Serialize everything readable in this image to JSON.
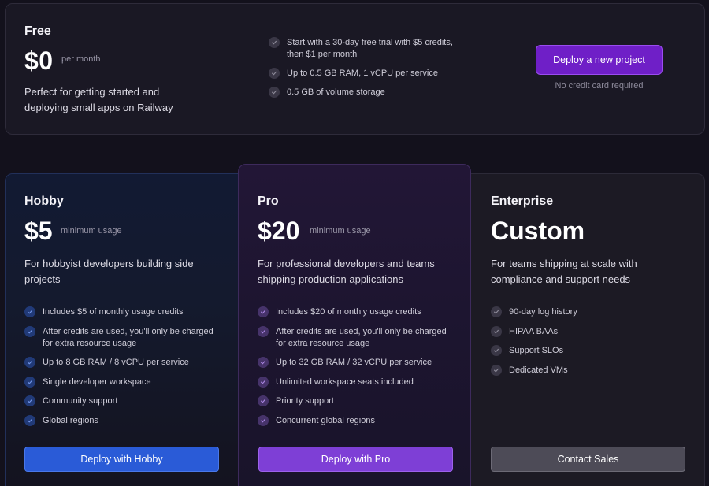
{
  "free": {
    "name": "Free",
    "price": "$0",
    "price_suffix": "per month",
    "description": "Perfect for getting started and deploying small apps on Railway",
    "features": [
      "Start with a 30-day free trial with $5 credits, then $1 per month",
      "Up to 0.5 GB RAM, 1 vCPU per service",
      "0.5 GB of volume storage"
    ],
    "cta": "Deploy a new project",
    "note": "No credit card required"
  },
  "hobby": {
    "name": "Hobby",
    "price": "$5",
    "price_suffix": "minimum usage",
    "description": "For hobbyist developers building side projects",
    "features": [
      "Includes $5 of monthly usage credits",
      "After credits are used, you'll only be charged for extra resource usage",
      "Up to 8 GB RAM / 8 vCPU per service",
      "Single developer workspace",
      "Community support",
      "Global regions"
    ],
    "cta": "Deploy with Hobby"
  },
  "pro": {
    "name": "Pro",
    "price": "$20",
    "price_suffix": "minimum usage",
    "description": "For professional developers and teams shipping production applications",
    "features": [
      "Includes $20 of monthly usage credits",
      "After credits are used, you'll only be charged for extra resource usage",
      "Up to 32 GB RAM / 32 vCPU per service",
      "Unlimited workspace seats included",
      "Priority support",
      "Concurrent global regions"
    ],
    "cta": "Deploy with Pro"
  },
  "enterprise": {
    "name": "Enterprise",
    "price": "Custom",
    "description": "For teams shipping at scale with compliance and support needs",
    "features": [
      "90-day log history",
      "HIPAA BAAs",
      "Support SLOs",
      "Dedicated VMs"
    ],
    "cta": "Contact Sales"
  },
  "colors": {
    "free_cta": "#6f1fc7",
    "hobby_cta": "#2a5bd7",
    "pro_cta": "#7e3fd6",
    "enterprise_cta": "#4d4b57"
  },
  "icons": {
    "feature_check": "check-circle-icon"
  }
}
